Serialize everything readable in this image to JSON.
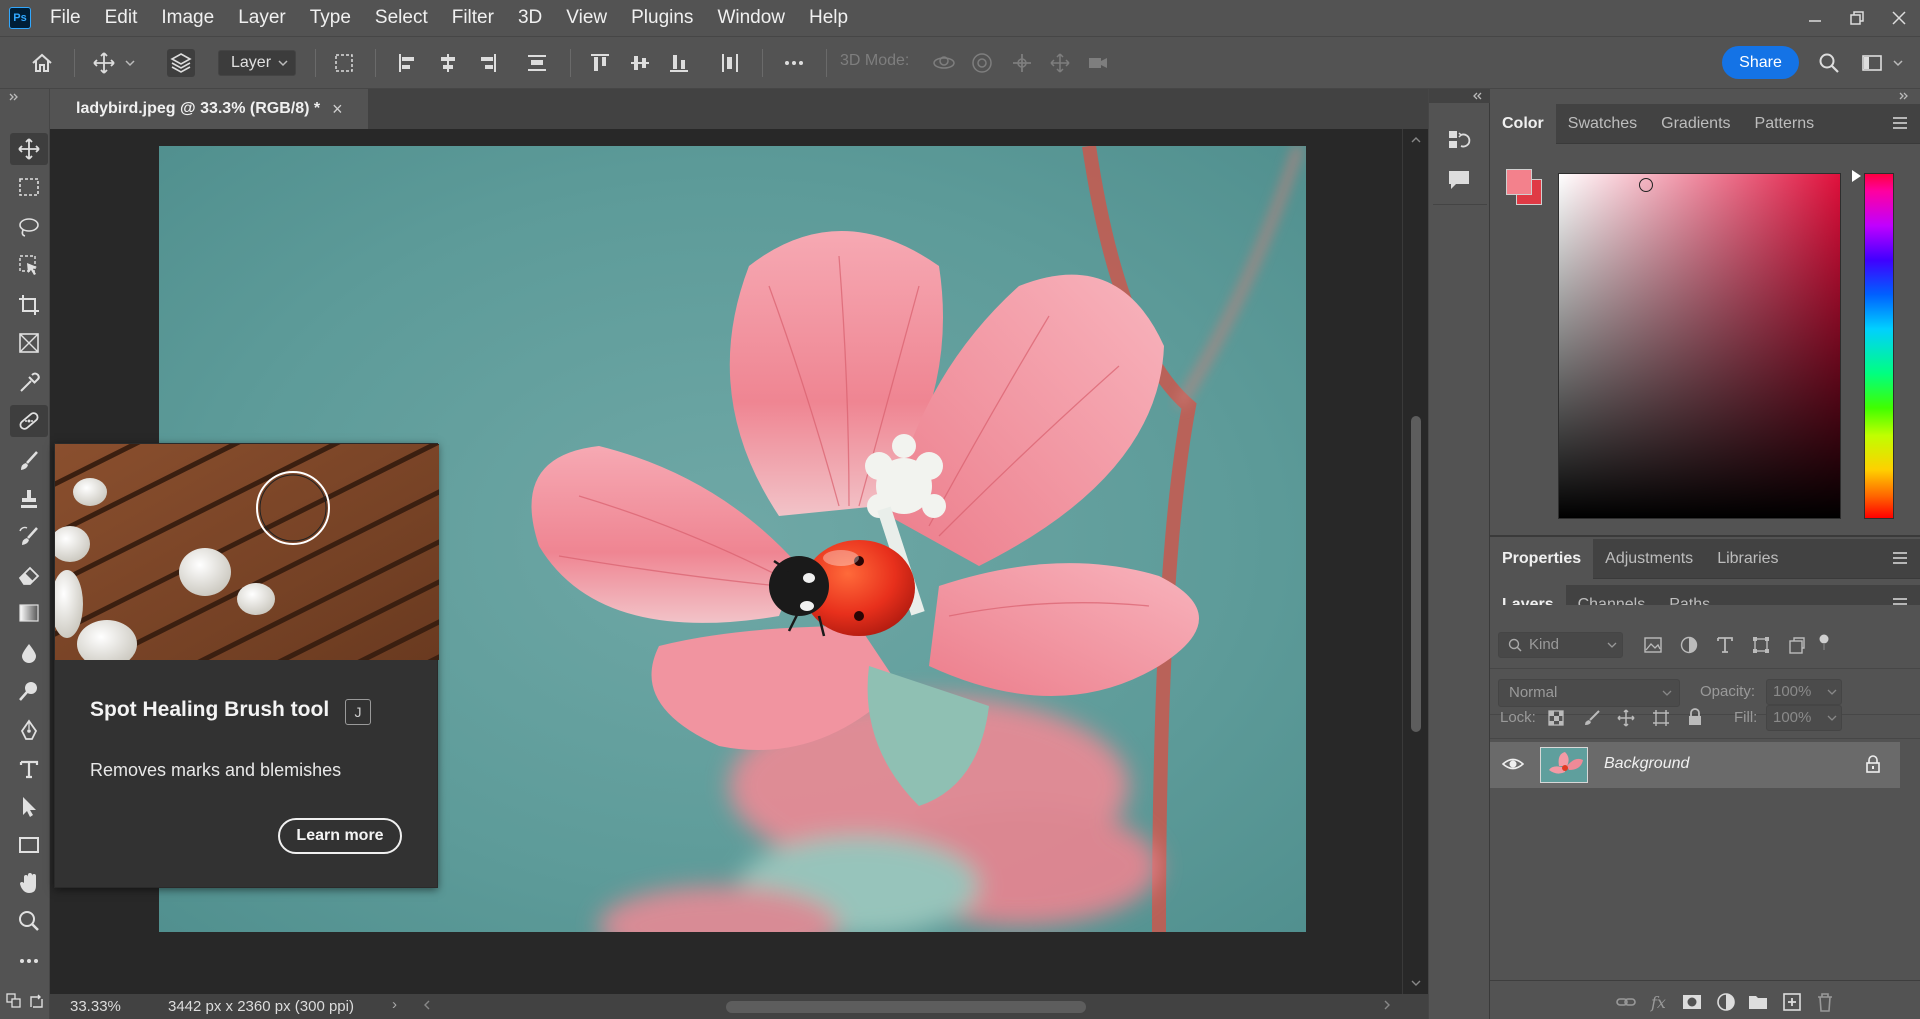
{
  "app": {
    "logo_text": "Ps",
    "menu": [
      "File",
      "Edit",
      "Image",
      "Layer",
      "Type",
      "Select",
      "Filter",
      "3D",
      "View",
      "Plugins",
      "Window",
      "Help"
    ]
  },
  "options_bar": {
    "auto_select_target": "Layer",
    "mode_3d_label": "3D Mode:",
    "share_label": "Share"
  },
  "document": {
    "tab_title": "ladybird.jpeg @ 33.3% (RGB/8) *",
    "close_glyph": "×"
  },
  "status_bar": {
    "zoom": "33.33%",
    "dimensions": "3442 px x 2360 px (300 ppi)",
    "arrow": "›"
  },
  "tooltip": {
    "title": "Spot Healing Brush tool",
    "shortcut": "J",
    "description": "Removes marks and blemishes",
    "button_label": "Learn more"
  },
  "color_panel": {
    "tabs": [
      "Color",
      "Swatches",
      "Gradients",
      "Patterns"
    ],
    "active_tab": "Color",
    "foreground_color": "#f3818c",
    "background_color": "#e03a45",
    "hue_color": "#e0103c"
  },
  "properties_panel": {
    "tabs": [
      "Properties",
      "Adjustments",
      "Libraries"
    ],
    "active_tab": "Properties"
  },
  "layers_panel": {
    "tabs": [
      "Layers",
      "Channels",
      "Paths"
    ],
    "active_tab": "Layers",
    "filter_placeholder": "Kind",
    "blend_mode": "Normal",
    "opacity_label": "Opacity:",
    "opacity_value": "100%",
    "lock_label": "Lock:",
    "fill_label": "Fill:",
    "fill_value": "100%",
    "layers": [
      {
        "name": "Background",
        "visible": true,
        "locked": true
      }
    ]
  }
}
